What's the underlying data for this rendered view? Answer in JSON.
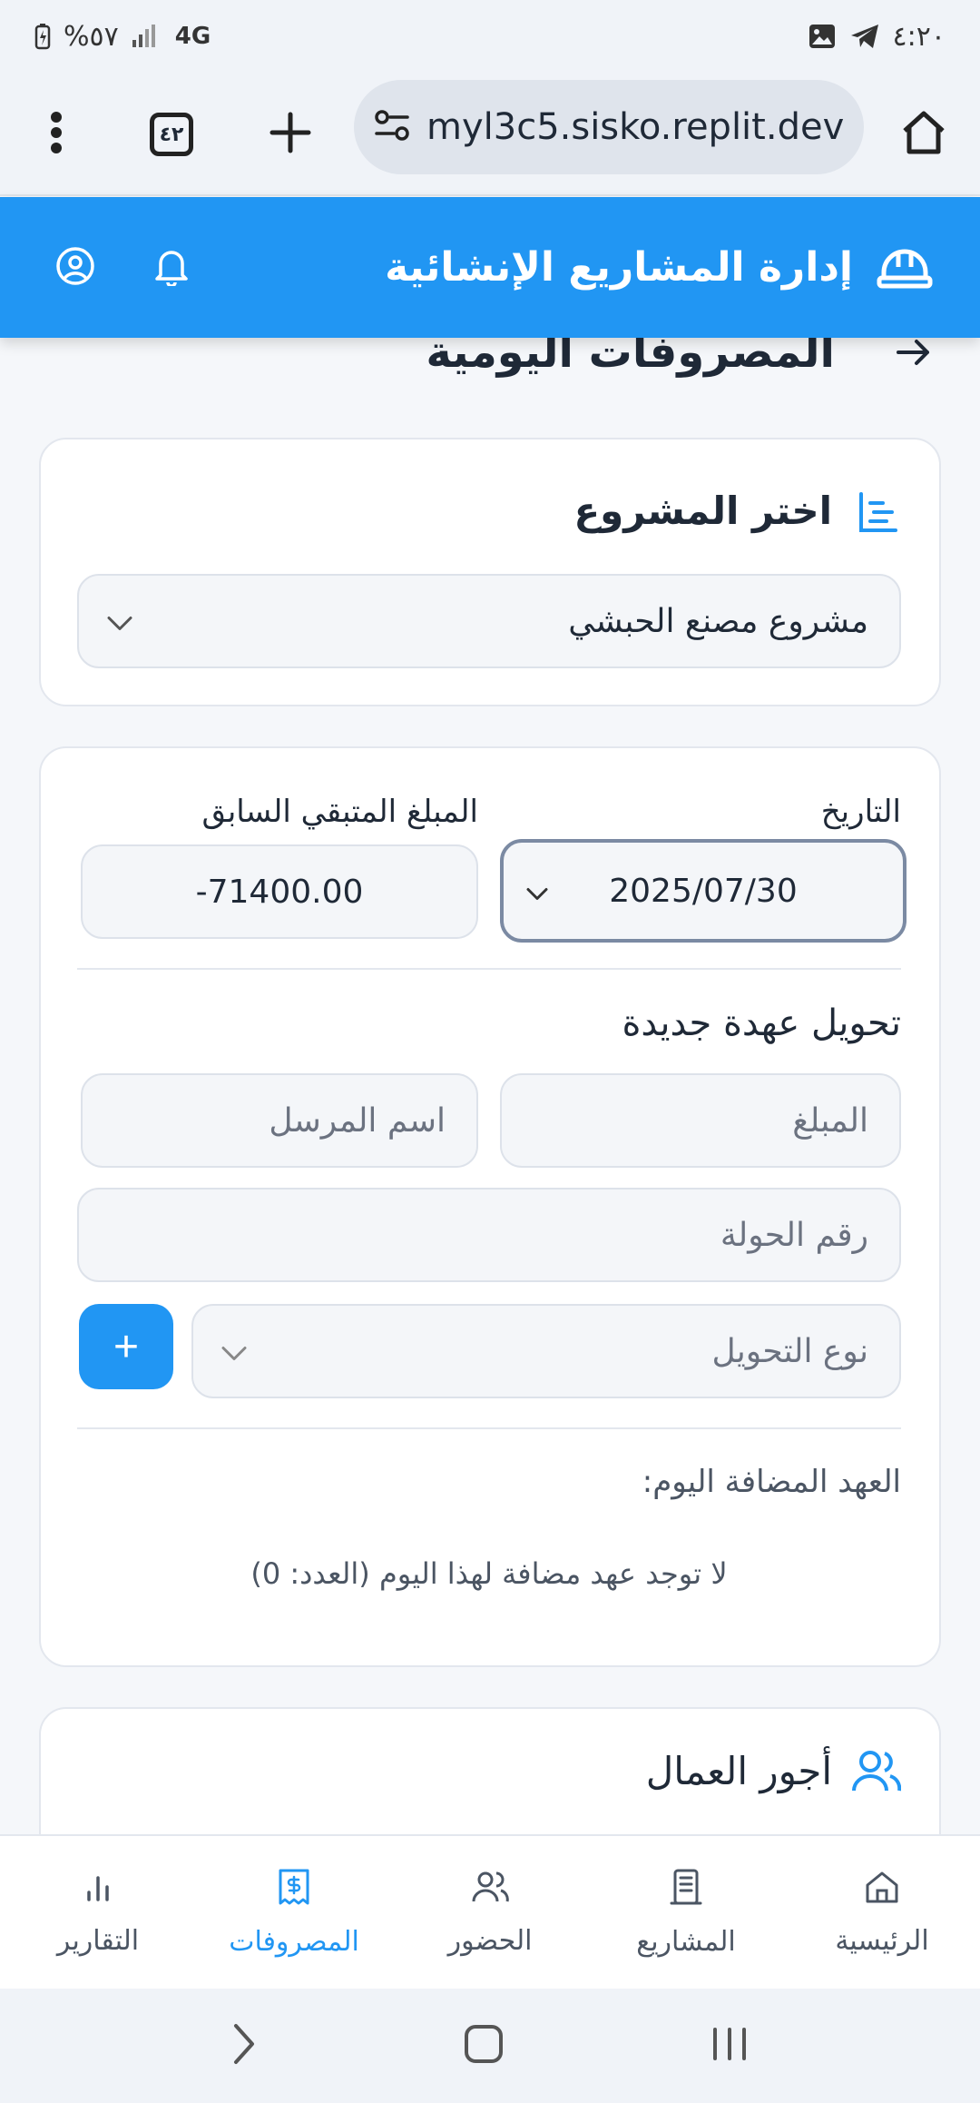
{
  "status_bar": {
    "time": "٤:٢٠",
    "battery": "%٥٧",
    "network": "4G"
  },
  "browser": {
    "url": "myl3c5.sisko.replit.dev",
    "tab_count": "٤٢"
  },
  "header": {
    "title": "إدارة المشاريع الإنشائية"
  },
  "page": {
    "title": "المصروفات اليومية"
  },
  "project_card": {
    "title": "اختر المشروع",
    "selected_project": "مشروع مصنع الحبشي"
  },
  "expense_card": {
    "date_label": "التاريخ",
    "date_value": "2025/07/30",
    "prev_balance_label": "المبلغ المتبقي السابق",
    "prev_balance_value": "-71400.00",
    "transfer_title": "تحويل عهدة جديدة",
    "amount_placeholder": "المبلغ",
    "sender_placeholder": "اسم المرسل",
    "transfer_number_placeholder": "رقم الحولة",
    "transfer_type_placeholder": "نوع التحويل",
    "add_label": "+",
    "added_today_label": "العهد المضافة اليوم:",
    "empty_message": "لا توجد عهد مضافة لهذا اليوم (العدد: 0)"
  },
  "workers_card": {
    "title": "أجور العمال"
  },
  "bottom_nav": {
    "items": [
      {
        "label": "الرئيسية",
        "icon": "home-icon"
      },
      {
        "label": "المشاريع",
        "icon": "building-icon"
      },
      {
        "label": "الحضور",
        "icon": "users-icon"
      },
      {
        "label": "المصروفات",
        "icon": "receipt-icon"
      },
      {
        "label": "التقارير",
        "icon": "bar-chart-icon"
      }
    ],
    "active_index": 3
  },
  "colors": {
    "primary": "#2196f3",
    "background": "#f5f7fa",
    "card": "#ffffff"
  }
}
